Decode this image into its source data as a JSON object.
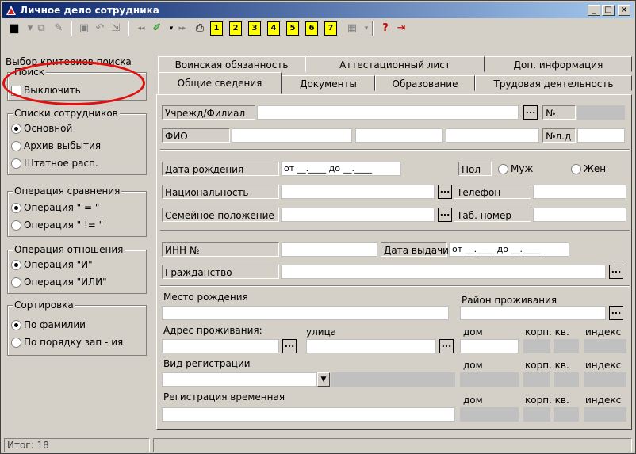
{
  "window": {
    "title": "Личное дело сотрудника",
    "min": "_",
    "max": "□",
    "close": "×"
  },
  "toolbar": {
    "numbered_buttons": [
      "1",
      "2",
      "3",
      "4",
      "5",
      "6",
      "7"
    ]
  },
  "left": {
    "criteria_label": "Выбор критериев поиска",
    "search": {
      "title": "Поиск",
      "disable_label": "Выключить"
    },
    "lists": {
      "title": "Списки сотрудников",
      "options": [
        "Основной",
        "Архив выбытия",
        "Штатное расп."
      ]
    },
    "compare": {
      "title": "Операция сравнения",
      "options": [
        "Операция \" = \"",
        "Операция \" != \""
      ]
    },
    "relation": {
      "title": "Операция отношения",
      "options": [
        "Операция \"И\"",
        "Операция \"ИЛИ\""
      ]
    },
    "sort": {
      "title": "Сортировка",
      "options": [
        "По фамилии",
        "По порядку зап - ия"
      ]
    }
  },
  "tabs": {
    "row1": [
      "Воинская обязанность",
      "Аттестационный лист",
      "Доп. информация"
    ],
    "row2": [
      "Общие сведения",
      "Документы",
      "Образование",
      "Трудовая деятельность"
    ]
  },
  "form": {
    "org_label": "Учрежд/Филиал",
    "num_label": "№",
    "fio_label": "ФИО",
    "case_num_label": "№л.д",
    "birth_label": "Дата рождения",
    "birth_range": "от __.____ до __.____",
    "gender_label": "Пол",
    "male": "Муж",
    "female": "Жен",
    "nationality_label": "Национальность",
    "phone_label": "Телефон",
    "marital_label": "Семейное положение",
    "tab_num_label": "Таб. номер",
    "inn_label": "ИНН  №",
    "issue_date_label": "Дата выдачи",
    "issue_range": "от __.____ до __.____",
    "citizenship_label": "Гражданство",
    "birthplace_label": "Место рождения",
    "district_label": "Район проживания",
    "address_label": "Адрес проживания:",
    "street_label": "улица",
    "house_label": "дом",
    "corp_label": "корп. кв.",
    "index_label": "индекс",
    "reg_type_label": "Вид регистрации",
    "temp_reg_label": "Регистрация временная",
    "ellipsis": "..."
  },
  "status": {
    "total": "Итог:  18"
  }
}
